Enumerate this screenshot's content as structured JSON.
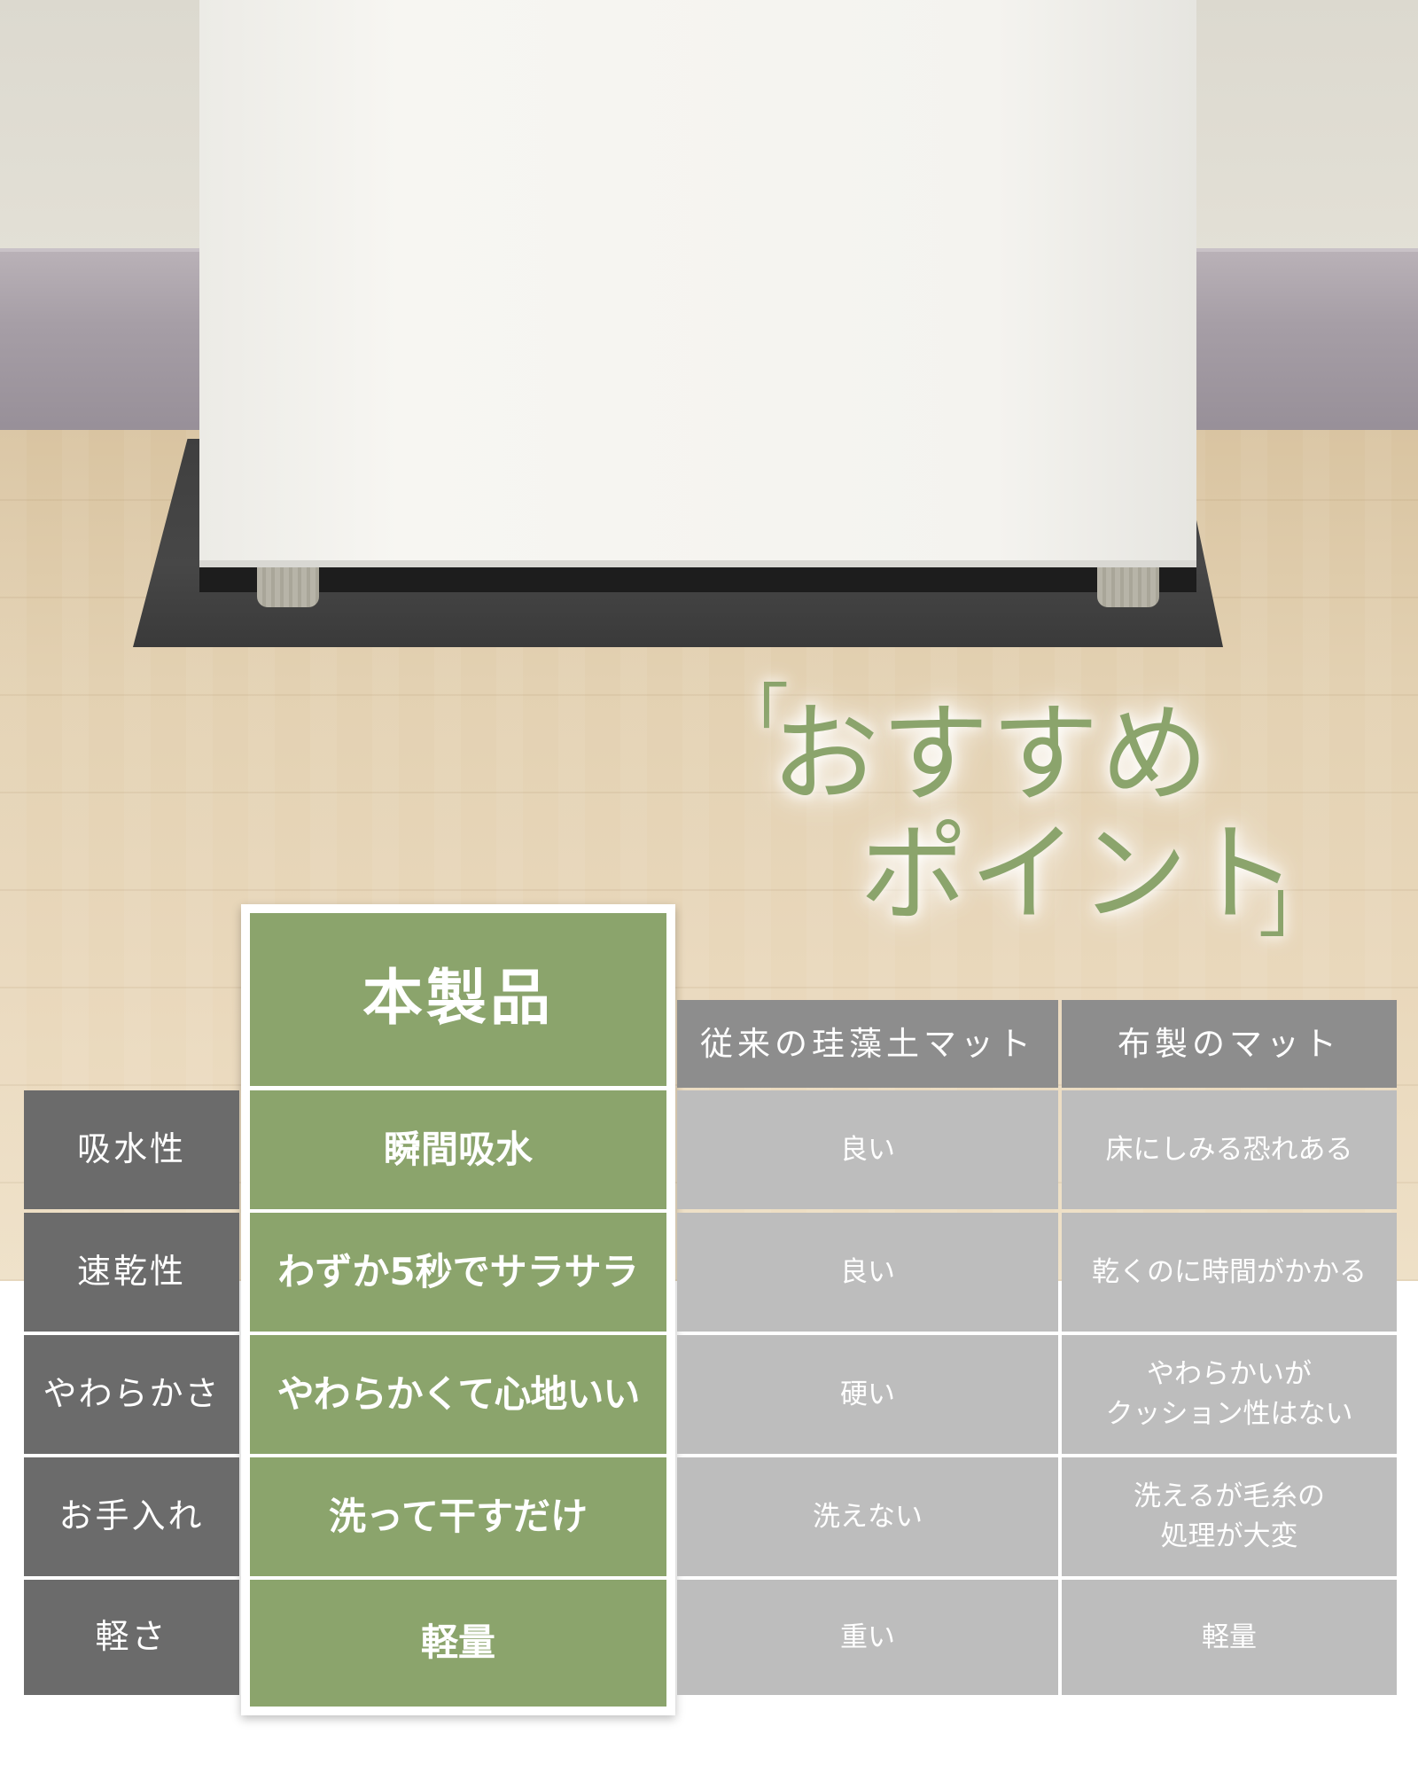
{
  "headline": {
    "open_bracket": "「",
    "line1": "おすすめ",
    "line2": "ポイント",
    "close_bracket": "」",
    "color": "#8ba46c"
  },
  "table": {
    "headers": {
      "product": "本製品",
      "diatomite": "従来の珪藻土マット",
      "fabric": "布製のマット"
    },
    "rows": [
      {
        "label": "吸水性",
        "product": "瞬間吸水",
        "diatomite": "良い",
        "fabric": "床にしみる恐れある"
      },
      {
        "label": "速乾性",
        "product": "わずか5秒でサラサラ",
        "diatomite": "良い",
        "fabric": "乾くのに時間がかかる"
      },
      {
        "label": "やわらかさ",
        "product": "やわらかくて心地いい",
        "diatomite": "硬い",
        "fabric": "やわらかいが\nクッション性はない"
      },
      {
        "label": "お手入れ",
        "product": "洗って干すだけ",
        "diatomite": "洗えない",
        "fabric": "洗えるが毛糸の\n処理が大変"
      },
      {
        "label": "軽さ",
        "product": "軽量",
        "diatomite": "重い",
        "fabric": "軽量"
      }
    ]
  },
  "colors": {
    "product_green": "#8ba46c",
    "label_gray": "#6b6b6b",
    "header_gray": "#8d8d8d",
    "comparison_gray": "#bdbdbd"
  }
}
